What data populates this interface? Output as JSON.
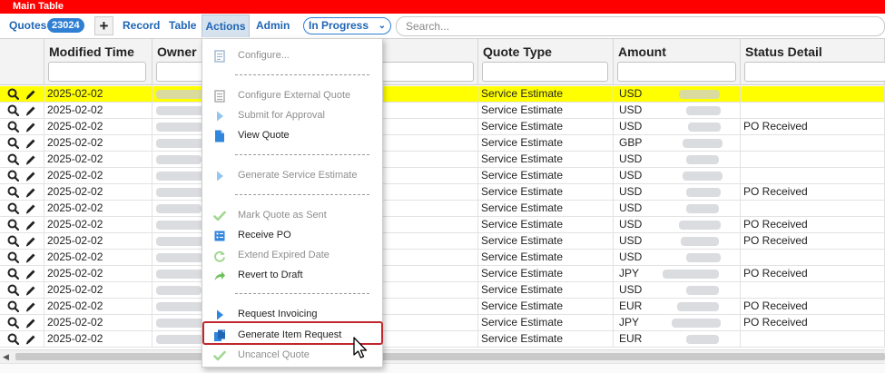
{
  "window": {
    "title": "Main Table"
  },
  "toolbar": {
    "quotes_label": "Quotes",
    "quotes_count": "23024",
    "add_label": "+",
    "record_label": "Record",
    "table_label": "Table",
    "actions_label": "Actions",
    "admin_label": "Admin",
    "status_filter": "In Progress",
    "search_placeholder": "Search..."
  },
  "table": {
    "columns": [
      "Modified Time",
      "Owner",
      "Quote Type",
      "Amount",
      "Status Detail"
    ],
    "rows": [
      {
        "modified": "2025-02-02",
        "quote_type": "Service Estimate",
        "currency": "USD",
        "status_detail": "",
        "selected": true
      },
      {
        "modified": "2025-02-02",
        "quote_type": "Service Estimate",
        "currency": "USD",
        "status_detail": ""
      },
      {
        "modified": "2025-02-02",
        "quote_type": "Service Estimate",
        "currency": "USD",
        "status_detail": "PO Received"
      },
      {
        "modified": "2025-02-02",
        "quote_type": "Service Estimate",
        "currency": "GBP",
        "status_detail": ""
      },
      {
        "modified": "2025-02-02",
        "quote_type": "Service Estimate",
        "currency": "USD",
        "status_detail": ""
      },
      {
        "modified": "2025-02-02",
        "quote_type": "Service Estimate",
        "currency": "USD",
        "status_detail": ""
      },
      {
        "modified": "2025-02-02",
        "quote_type": "Service Estimate",
        "currency": "USD",
        "status_detail": "PO Received"
      },
      {
        "modified": "2025-02-02",
        "quote_type": "Service Estimate",
        "currency": "USD",
        "status_detail": ""
      },
      {
        "modified": "2025-02-02",
        "quote_type": "Service Estimate",
        "currency": "USD",
        "status_detail": "PO Received"
      },
      {
        "modified": "2025-02-02",
        "quote_type": "Service Estimate",
        "currency": "USD",
        "status_detail": "PO Received"
      },
      {
        "modified": "2025-02-02",
        "quote_type": "Service Estimate",
        "currency": "USD",
        "status_detail": ""
      },
      {
        "modified": "2025-02-02",
        "quote_type": "Service Estimate",
        "currency": "JPY",
        "status_detail": "PO Received"
      },
      {
        "modified": "2025-02-02",
        "quote_type": "Service Estimate",
        "currency": "USD",
        "status_detail": ""
      },
      {
        "modified": "2025-02-02",
        "quote_type": "Service Estimate",
        "currency": "EUR",
        "status_detail": "PO Received"
      },
      {
        "modified": "2025-02-02",
        "quote_type": "Service Estimate",
        "currency": "JPY",
        "status_detail": "PO Received"
      },
      {
        "modified": "2025-02-02",
        "quote_type": "Service Estimate",
        "currency": "EUR",
        "status_detail": ""
      }
    ]
  },
  "actions_menu": {
    "items": [
      {
        "label": "Configure...",
        "icon": "configure-icon",
        "enabled": false
      },
      {
        "label": "Configure External Quote",
        "icon": "external-quote-icon",
        "enabled": false
      },
      {
        "label": "Submit for Approval",
        "icon": "play-arrow-icon",
        "enabled": false
      },
      {
        "label": "View Quote",
        "icon": "document-icon",
        "enabled": true
      },
      {
        "label": "Generate Service Estimate",
        "icon": "play-arrow-icon",
        "enabled": false
      },
      {
        "label": "Mark Quote as Sent",
        "icon": "checkmark-icon",
        "enabled": false
      },
      {
        "label": "Receive PO",
        "icon": "form-icon",
        "enabled": true
      },
      {
        "label": "Extend Expired Date",
        "icon": "refresh-icon",
        "enabled": false
      },
      {
        "label": "Revert to Draft",
        "icon": "share-arrow-icon",
        "enabled": true
      },
      {
        "label": "Request Invoicing",
        "icon": "play-arrow-icon",
        "enabled": true
      },
      {
        "label": "Generate Item Request",
        "icon": "documents-icon",
        "enabled": true,
        "highlighted": true
      },
      {
        "label": "Uncancel Quote",
        "icon": "checkmark-icon",
        "enabled": false
      }
    ]
  },
  "colors": {
    "title_bar": "#ff0000",
    "link_blue": "#1f66b5",
    "count_badge": "#2f7fd3",
    "selected_row": "#ffff00",
    "highlight_border": "#c0282d",
    "menu_icon_blue": "#2f86dd",
    "menu_icon_green": "#6cc25a"
  }
}
